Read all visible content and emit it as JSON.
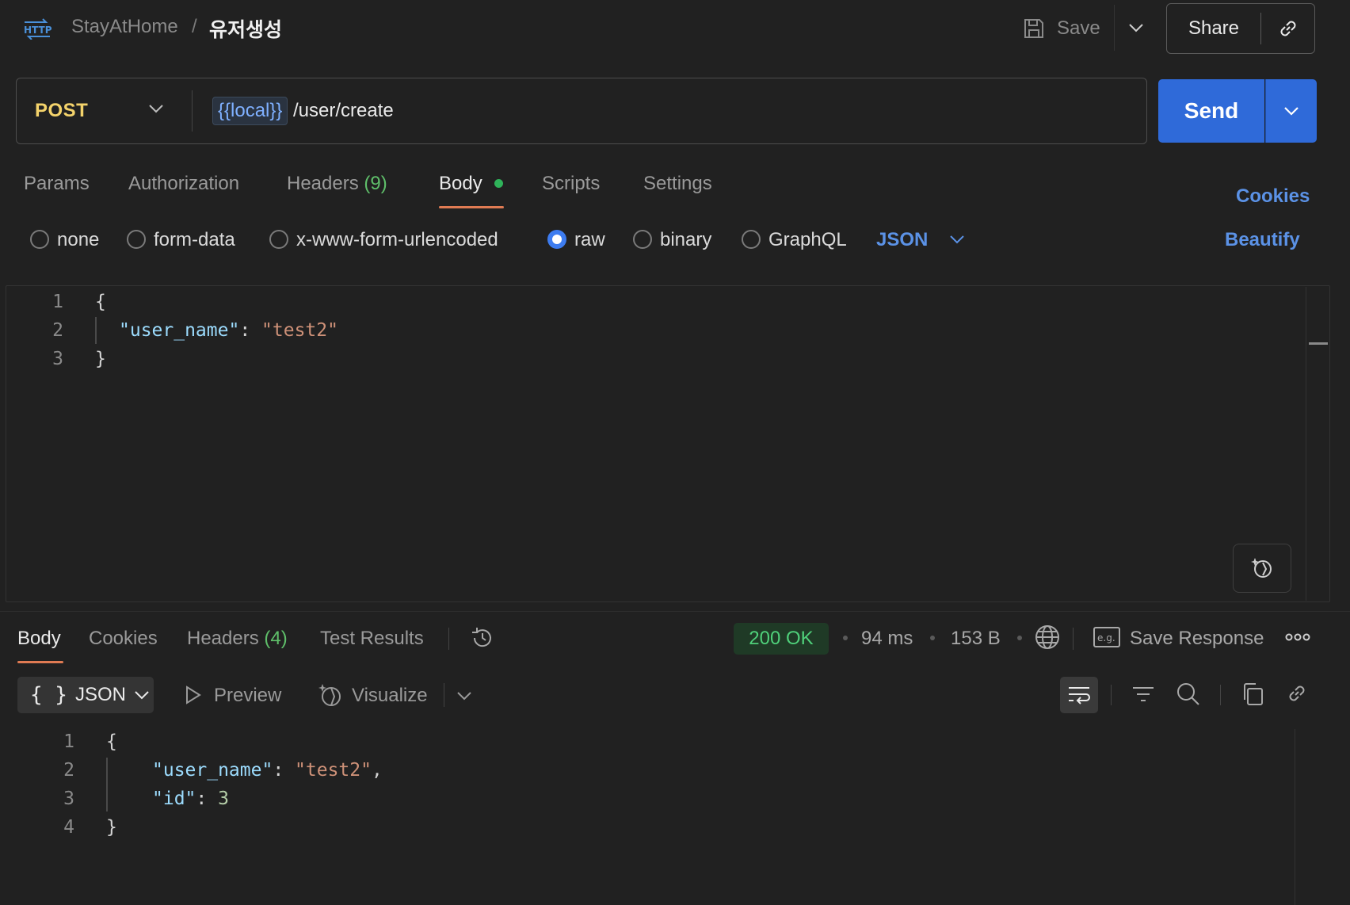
{
  "header": {
    "breadcrumb_parent": "StayAtHome",
    "breadcrumb_sep": "/",
    "title": "유저생성",
    "save_label": "Save",
    "share_label": "Share",
    "icons": [
      "http-icon",
      "save-icon",
      "chevron-down-icon",
      "link-icon"
    ]
  },
  "request": {
    "method": "POST",
    "url_variable": "{{local}}",
    "url_path": "/user/create",
    "send_label": "Send"
  },
  "request_tabs": {
    "params": "Params",
    "authorization": "Authorization",
    "headers": "Headers",
    "headers_count": "(9)",
    "body": "Body",
    "scripts": "Scripts",
    "settings": "Settings",
    "active": "Body",
    "cookies_link": "Cookies"
  },
  "body_types": {
    "options": [
      "none",
      "form-data",
      "x-www-form-urlencoded",
      "raw",
      "binary",
      "GraphQL"
    ],
    "selected": "raw",
    "language": "JSON",
    "beautify_label": "Beautify"
  },
  "request_body": {
    "lines": [
      {
        "n": "1",
        "text": "{"
      },
      {
        "n": "2",
        "key": "\"user_name\"",
        "sep": ": ",
        "value": "\"test2\""
      },
      {
        "n": "3",
        "text": "}"
      }
    ]
  },
  "response_tabs": {
    "body": "Body",
    "cookies": "Cookies",
    "headers": "Headers",
    "headers_count": "(4)",
    "test_results": "Test Results",
    "active": "Body"
  },
  "response_meta": {
    "status": "200 OK",
    "time": "94 ms",
    "size": "153 B",
    "save_response_label": "Save Response",
    "status_color": "#4fd07a"
  },
  "response_toolbar": {
    "format": "JSON",
    "preview_label": "Preview",
    "visualize_label": "Visualize"
  },
  "response_body": {
    "lines": [
      {
        "n": "1",
        "text": "{"
      },
      {
        "n": "2",
        "key": "\"user_name\"",
        "sep": ": ",
        "value": "\"test2\"",
        "trail": ","
      },
      {
        "n": "3",
        "key": "\"id\"",
        "sep": ": ",
        "value": "3"
      },
      {
        "n": "4",
        "text": "}"
      }
    ]
  },
  "colors": {
    "background": "#212121",
    "accent_blue": "#2f6ad9",
    "method": "#f4d36b",
    "active_underline": "#e07b53",
    "link": "#5b92e6"
  }
}
